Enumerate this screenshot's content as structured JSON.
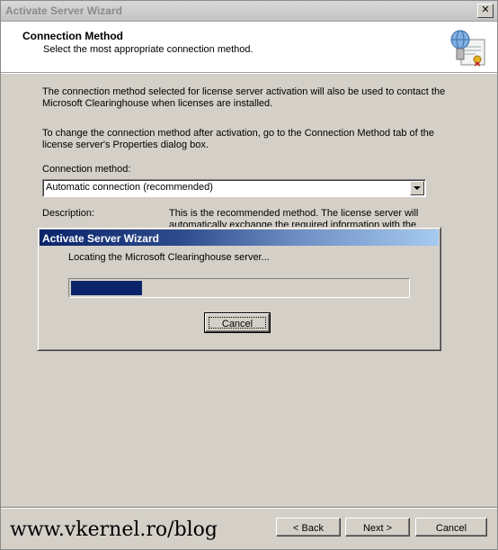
{
  "window": {
    "title": "Activate Server Wizard",
    "close_glyph": "✕"
  },
  "header": {
    "title": "Connection Method",
    "subtitle": "Select the most appropriate connection method.",
    "icon": "certificate-server-icon"
  },
  "body": {
    "paragraph1": "The connection method selected for license server activation will also be used to contact the Microsoft Clearinghouse when licenses are installed.",
    "paragraph2": "To change the connection method after activation, go to the Connection Method tab of the license server's Properties dialog box.",
    "connection_label": "Connection method:",
    "connection_value": "Automatic connection (recommended)",
    "description_label": "Description:",
    "description_text": "This is the recommended method. The license server will automatically exchange the required information with the"
  },
  "progress_dialog": {
    "title": "Activate Server Wizard",
    "message": "Locating the Microsoft Clearinghouse server...",
    "progress_percent": 21,
    "cancel_label": "Cancel"
  },
  "footer": {
    "back_label": "< Back",
    "next_label": "Next >",
    "cancel_label": "Cancel"
  },
  "watermark": "www.vkernel.ro/blog"
}
